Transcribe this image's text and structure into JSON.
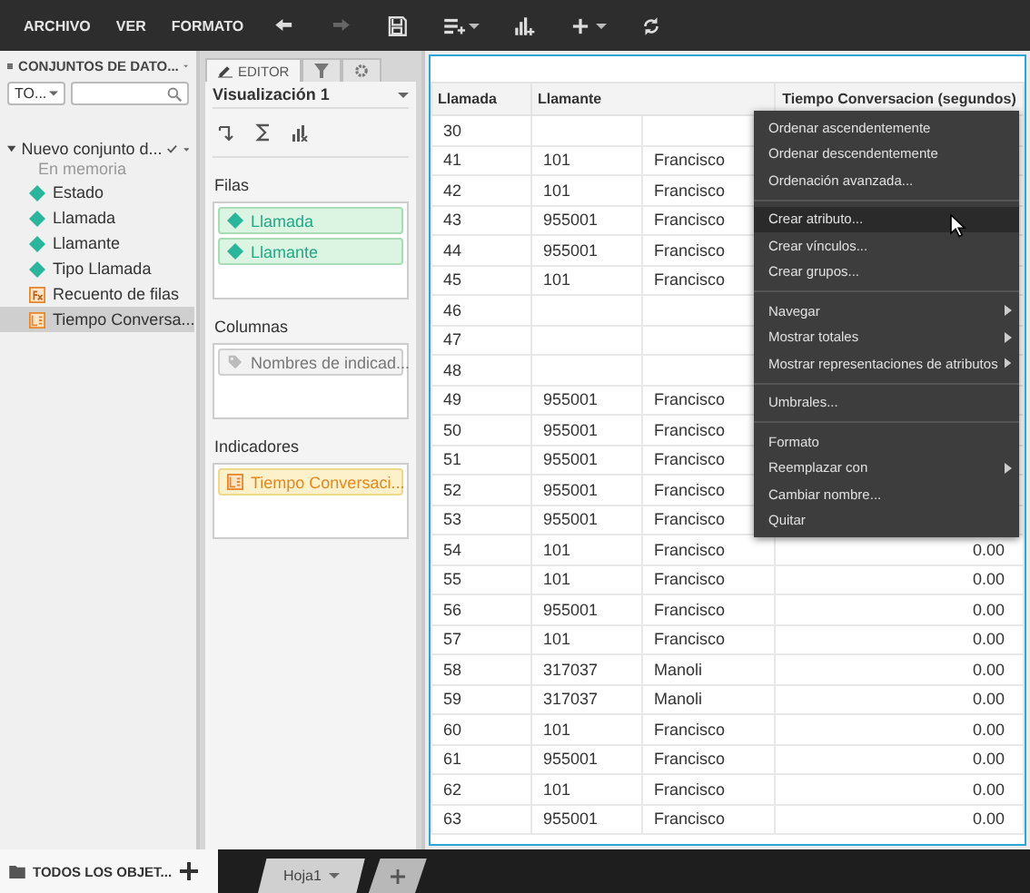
{
  "toolbar": {
    "menus": [
      "ARCHIVO",
      "VER",
      "FORMATO"
    ],
    "tools": [
      {
        "kind": "undo",
        "disabled": false,
        "caret": false
      },
      {
        "kind": "redo",
        "disabled": true,
        "caret": false
      },
      {
        "kind": "save",
        "disabled": false,
        "caret": false
      },
      {
        "kind": "add-dataset",
        "disabled": false,
        "caret": true
      },
      {
        "kind": "add-chart",
        "disabled": false,
        "caret": false
      },
      {
        "kind": "insert",
        "disabled": false,
        "caret": true
      },
      {
        "kind": "refresh",
        "disabled": false,
        "caret": false
      }
    ]
  },
  "datasets_panel": {
    "title": "CONJUNTOS DE DATO...",
    "filter": "TO...",
    "dataset": {
      "name": "Nuevo conjunto d...",
      "subtitle": "En memoria",
      "expanded": true,
      "children": [
        {
          "label": "Estado",
          "kind": "attribute",
          "selected": false
        },
        {
          "label": "Llamada",
          "kind": "attribute",
          "selected": false
        },
        {
          "label": "Llamante",
          "kind": "attribute",
          "selected": false
        },
        {
          "label": "Tipo Llamada",
          "kind": "attribute",
          "selected": false
        },
        {
          "label": "Recuento de filas",
          "kind": "count",
          "selected": false
        },
        {
          "label": "Tiempo Conversa...",
          "kind": "metric",
          "selected": true
        }
      ]
    },
    "footer": "TODOS LOS OBJET..."
  },
  "editor_panel": {
    "tabs": [
      {
        "kind": "editor",
        "label": "EDITOR",
        "selected": true
      },
      {
        "kind": "filter",
        "selected": false
      },
      {
        "kind": "settings",
        "selected": false
      }
    ],
    "visualization": "Visualización 1",
    "zones": [
      {
        "title": "Filas",
        "items": [
          {
            "label": "Llamada",
            "kind": "attribute"
          },
          {
            "label": "Llamante",
            "kind": "attribute"
          }
        ]
      },
      {
        "title": "Columnas",
        "items": [
          {
            "label": "Nombres de indicad...",
            "kind": "names"
          }
        ]
      },
      {
        "title": "Indicadores",
        "items": [
          {
            "label": "Tiempo Conversaci...",
            "kind": "metric"
          }
        ]
      }
    ]
  },
  "table": {
    "columns": [
      "Llamada",
      "Llamante",
      "Tiempo Conversacion (segundos)"
    ],
    "rows": [
      {
        "llamada": "30"
      },
      {
        "llamada": "41",
        "llamante": "101",
        "nombre": "Francisco"
      },
      {
        "llamada": "42",
        "llamante": "101",
        "nombre": "Francisco"
      },
      {
        "llamada": "43",
        "llamante": "955001",
        "nombre": "Francisco"
      },
      {
        "llamada": "44",
        "llamante": "955001",
        "nombre": "Francisco"
      },
      {
        "llamada": "45",
        "llamante": "101",
        "nombre": "Francisco"
      },
      {
        "llamada": "46"
      },
      {
        "llamada": "47"
      },
      {
        "llamada": "48"
      },
      {
        "llamada": "49",
        "llamante": "955001",
        "nombre": "Francisco"
      },
      {
        "llamada": "50",
        "llamante": "955001",
        "nombre": "Francisco"
      },
      {
        "llamada": "51",
        "llamante": "955001",
        "nombre": "Francisco"
      },
      {
        "llamada": "52",
        "llamante": "955001",
        "nombre": "Francisco"
      },
      {
        "llamada": "53",
        "llamante": "955001",
        "nombre": "Francisco"
      },
      {
        "llamada": "54",
        "llamante": "101",
        "nombre": "Francisco",
        "tiempo": "0.00"
      },
      {
        "llamada": "55",
        "llamante": "101",
        "nombre": "Francisco",
        "tiempo": "0.00"
      },
      {
        "llamada": "56",
        "llamante": "955001",
        "nombre": "Francisco",
        "tiempo": "0.00"
      },
      {
        "llamada": "57",
        "llamante": "101",
        "nombre": "Francisco",
        "tiempo": "0.00"
      },
      {
        "llamada": "58",
        "llamante": "317037",
        "nombre": "Manoli",
        "tiempo": "0.00"
      },
      {
        "llamada": "59",
        "llamante": "317037",
        "nombre": "Manoli",
        "tiempo": "0.00"
      },
      {
        "llamada": "60",
        "llamante": "101",
        "nombre": "Francisco",
        "tiempo": "0.00"
      },
      {
        "llamada": "61",
        "llamante": "955001",
        "nombre": "Francisco",
        "tiempo": "0.00"
      },
      {
        "llamada": "62",
        "llamante": "101",
        "nombre": "Francisco",
        "tiempo": "0.00"
      },
      {
        "llamada": "63",
        "llamante": "955001",
        "nombre": "Francisco",
        "tiempo": "0.00"
      }
    ]
  },
  "context_menu": {
    "groups": [
      [
        {
          "label": "Ordenar ascendentemente",
          "submenu": false,
          "selected": false
        },
        {
          "label": "Ordenar descendentemente",
          "submenu": false,
          "selected": false
        },
        {
          "label": "Ordenación avanzada...",
          "submenu": false,
          "selected": false
        }
      ],
      [
        {
          "label": "Crear atributo...",
          "submenu": false,
          "selected": true
        },
        {
          "label": "Crear vínculos...",
          "submenu": false,
          "selected": false
        },
        {
          "label": "Crear grupos...",
          "submenu": false,
          "selected": false
        }
      ],
      [
        {
          "label": "Navegar",
          "submenu": true,
          "selected": false
        },
        {
          "label": "Mostrar totales",
          "submenu": true,
          "selected": false
        },
        {
          "label": "Mostrar representaciones de atributos",
          "submenu": true,
          "selected": false
        }
      ],
      [
        {
          "label": "Umbrales...",
          "submenu": false,
          "selected": false
        }
      ],
      [
        {
          "label": "Formato",
          "submenu": false,
          "selected": false
        },
        {
          "label": "Reemplazar con",
          "submenu": true,
          "selected": false
        },
        {
          "label": "Cambiar nombre...",
          "submenu": false,
          "selected": false
        },
        {
          "label": "Quitar",
          "submenu": false,
          "selected": false
        }
      ]
    ]
  },
  "sheets": [
    {
      "label": "Hoja1",
      "selected": true
    }
  ]
}
